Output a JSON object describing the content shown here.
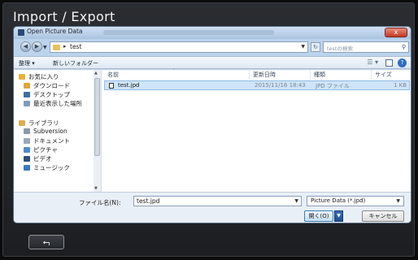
{
  "app": {
    "title": "Import / Export",
    "back_glyph": "⮢"
  },
  "dialog": {
    "title": "Open Picture Data",
    "close_glyph": "x",
    "address": {
      "path": "test",
      "sep": "▸"
    },
    "search": {
      "placeholder": "testの検索"
    },
    "toolbar": {
      "organize": "整理 ▾",
      "new_folder": "新しいフォルダー",
      "view_glyph": "☰ ▾"
    },
    "nav": {
      "items": [
        {
          "label": "お気に入り",
          "color": "#e6b23a"
        },
        {
          "label": "ダウンロード",
          "color": "#e2a43c"
        },
        {
          "label": "デスクトップ",
          "color": "#3d6ea8"
        },
        {
          "label": "最近表示した場所",
          "color": "#7f9bbd"
        },
        {
          "label": "ライブラリ",
          "color": "#d8b052"
        },
        {
          "label": "Subversion",
          "color": "#8a97a8"
        },
        {
          "label": "ドキュメント",
          "color": "#9aa7b8"
        },
        {
          "label": "ピクチャ",
          "color": "#4f8bc9"
        },
        {
          "label": "ビデオ",
          "color": "#2f4e7a"
        },
        {
          "label": "ミュージック",
          "color": "#3a79c4"
        }
      ]
    },
    "columns": {
      "name": "名前",
      "date": "更新日時",
      "type": "種類",
      "size": "サイズ"
    },
    "files": [
      {
        "name": "test.jpd",
        "date": "2015/11/16 18:43",
        "type": "JPD ファイル",
        "size": "1 KB"
      }
    ],
    "filename": {
      "label": "ファイル名(N):",
      "value": "test.jpd"
    },
    "filter": {
      "value": "Picture Data (*.jpd)"
    },
    "open_button": "開く(O)",
    "cancel_button": "キャンセル"
  }
}
